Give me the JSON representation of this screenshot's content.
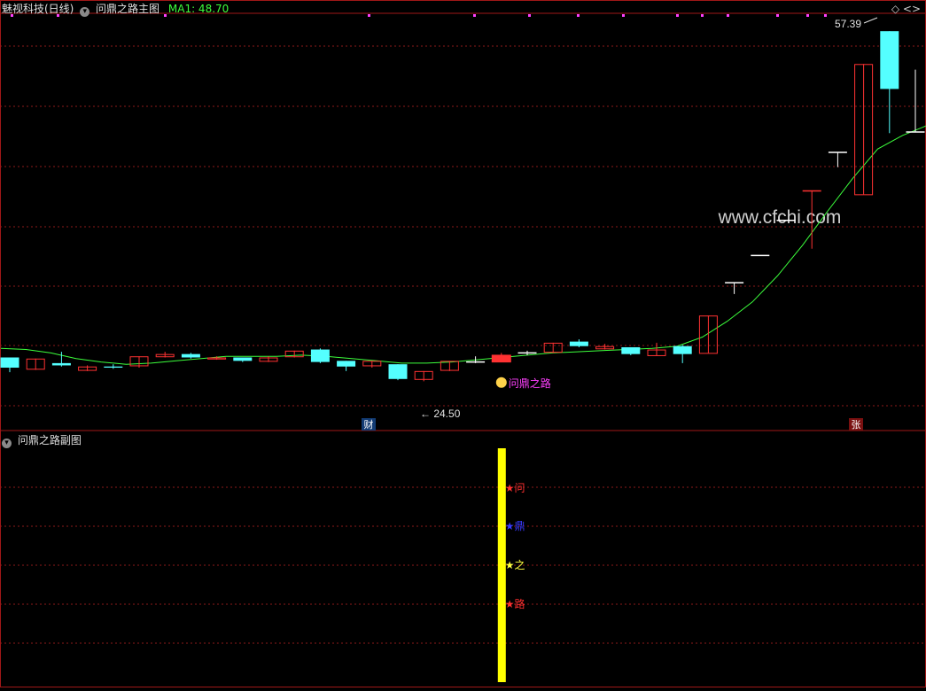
{
  "header": {
    "stock_name": "魅视科技(日线)",
    "main_title": "问鼎之路主图",
    "ma_label": "MA1: 48.70"
  },
  "sub": {
    "title": "问鼎之路副图"
  },
  "watermark": "www.cfchi.com",
  "labels": {
    "high": "57.39",
    "low": "24.50",
    "signal": "问鼎之路",
    "cai": "财",
    "zhang": "张",
    "star_wen": "问",
    "star_ding": "鼎",
    "star_zhi": "之",
    "star_lu": "路"
  },
  "colors": {
    "up": "#ff3232",
    "down": "#54ffff",
    "doji": "#ffffff",
    "ma": "#3cff3c",
    "bar": "#ffff00",
    "grid": "#8b1a1a",
    "border": "#a01818",
    "signal": "#ff40ff"
  },
  "chart_data": {
    "type": "candlestick",
    "y_range_price": [
      23.0,
      58.5
    ],
    "candles": [
      {
        "o": 28.2,
        "c": 27.3,
        "h": 28.2,
        "l": 26.9
      },
      {
        "o": 27.2,
        "c": 28.1,
        "h": 28.1,
        "l": 27.1
      },
      {
        "o": 27.7,
        "c": 27.5,
        "h": 28.7,
        "l": 27.4
      },
      {
        "o": 27.1,
        "c": 27.4,
        "h": 27.5,
        "l": 27.0
      },
      {
        "o": 27.4,
        "c": 27.3,
        "h": 27.6,
        "l": 27.2
      },
      {
        "o": 27.5,
        "c": 28.3,
        "h": 28.3,
        "l": 27.3
      },
      {
        "o": 28.3,
        "c": 28.5,
        "h": 28.7,
        "l": 28.2
      },
      {
        "o": 28.5,
        "c": 28.2,
        "h": 28.6,
        "l": 28.1
      },
      {
        "o": 28.1,
        "c": 28.2,
        "h": 28.3,
        "l": 28.0
      },
      {
        "o": 28.2,
        "c": 27.9,
        "h": 28.2,
        "l": 27.8
      },
      {
        "o": 27.9,
        "c": 28.2,
        "h": 28.3,
        "l": 27.8
      },
      {
        "o": 28.3,
        "c": 28.8,
        "h": 28.8,
        "l": 28.2
      },
      {
        "o": 28.9,
        "c": 27.8,
        "h": 29.0,
        "l": 27.7
      },
      {
        "o": 27.9,
        "c": 27.4,
        "h": 27.9,
        "l": 27.0
      },
      {
        "o": 27.5,
        "c": 27.9,
        "h": 27.9,
        "l": 27.3
      },
      {
        "o": 27.6,
        "c": 26.3,
        "h": 27.6,
        "l": 26.2
      },
      {
        "o": 26.3,
        "c": 27.0,
        "h": 27.0,
        "l": 26.1
      },
      {
        "o": 27.1,
        "c": 27.9,
        "h": 27.9,
        "l": 27.0
      },
      {
        "o": 27.8,
        "c": 27.8,
        "h": 28.3,
        "l": 27.7
      },
      {
        "o": 27.8,
        "c": 28.4,
        "h": 28.6,
        "l": 27.8
      },
      {
        "o": 28.6,
        "c": 28.6,
        "h": 28.8,
        "l": 28.4
      },
      {
        "o": 28.7,
        "c": 29.5,
        "h": 29.5,
        "l": 28.6
      },
      {
        "o": 29.6,
        "c": 29.2,
        "h": 29.8,
        "l": 29.1
      },
      {
        "o": 29.0,
        "c": 29.2,
        "h": 29.4,
        "l": 28.9
      },
      {
        "o": 29.1,
        "c": 28.5,
        "h": 29.1,
        "l": 28.4
      },
      {
        "o": 28.4,
        "c": 28.9,
        "h": 29.5,
        "l": 28.4
      },
      {
        "o": 29.2,
        "c": 28.5,
        "h": 29.3,
        "l": 27.7
      },
      {
        "o": 28.6,
        "c": 31.9,
        "h": 31.9,
        "l": 28.6
      },
      {
        "o": 34.8,
        "c": 34.8,
        "h": 34.8,
        "l": 33.8
      },
      {
        "o": 37.2,
        "c": 37.2,
        "h": 37.2,
        "l": 37.2
      },
      {
        "o": 40.3,
        "c": 40.3,
        "h": 40.3,
        "l": 40.3
      },
      {
        "o": 42.9,
        "c": 42.9,
        "h": 42.9,
        "l": 37.8
      },
      {
        "o": 46.3,
        "c": 46.3,
        "h": 46.3,
        "l": 45.0
      },
      {
        "o": 42.6,
        "c": 54.1,
        "h": 54.1,
        "l": 42.6
      },
      {
        "o": 57.0,
        "c": 51.9,
        "h": 57.0,
        "l": 48.0
      },
      {
        "o": 48.1,
        "c": 48.1,
        "h": 53.6,
        "l": 48.1
      }
    ],
    "ma1": [
      29.0,
      28.9,
      28.6,
      28.1,
      27.8,
      27.6,
      27.7,
      27.9,
      28.1,
      28.3,
      28.3,
      28.3,
      28.4,
      28.3,
      28.1,
      27.9,
      27.7,
      27.7,
      27.8,
      28.0,
      28.2,
      28.4,
      28.6,
      28.7,
      28.8,
      28.9,
      29.0,
      29.2,
      30.0,
      31.4,
      33.1,
      35.4,
      38.1,
      41.1,
      44.0,
      46.6,
      47.8,
      48.7
    ],
    "high_label_value": 57.39,
    "low_label_value": 24.5,
    "signal_candle_index": 19,
    "highlight_bar_index": 19
  }
}
